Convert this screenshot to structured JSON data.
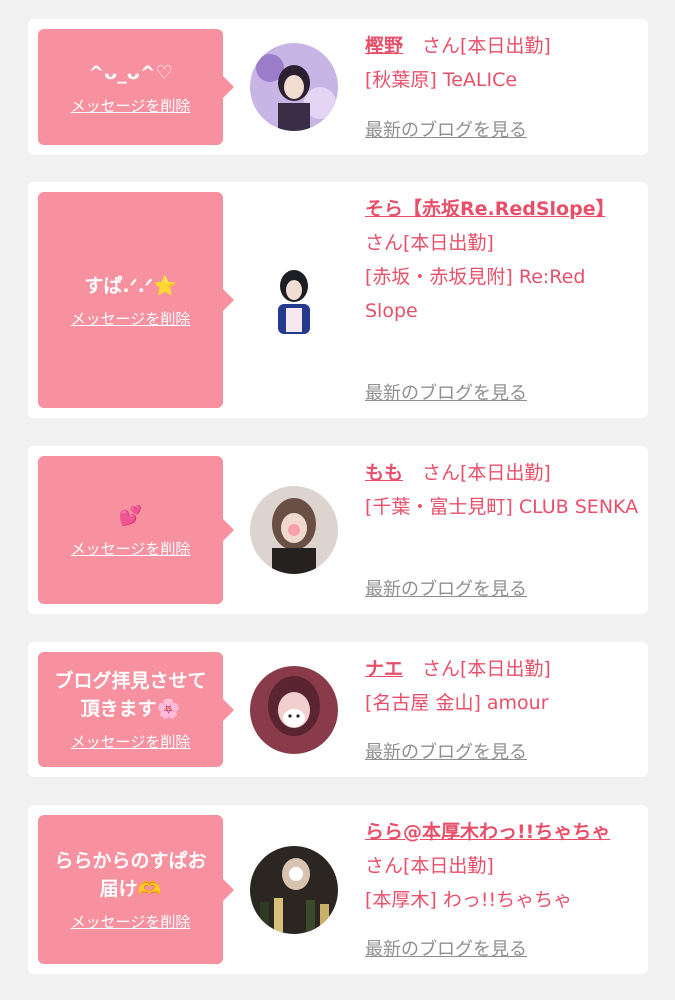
{
  "cards": [
    {
      "message": "^ᴗ_ᴗ^♡",
      "delete_label": "メッセージを削除",
      "name": "樫野",
      "honorific": "　さん[本日出勤]",
      "shop": "[秋葉原] TeALICe",
      "blog_label": "最新のブログを見る"
    },
    {
      "message": "すぱ.ᐟ.ᐟ⭐",
      "delete_label": "メッセージを削除",
      "name": "そら【赤坂Re.RedSlope】",
      "honorific": "　さん[本日出勤]",
      "shop": "[赤坂・赤坂見附] Re:Red Slope",
      "blog_label": "最新のブログを見る"
    },
    {
      "message": "💕",
      "delete_label": "メッセージを削除",
      "name": "もも",
      "honorific": "　さん[本日出勤]",
      "shop": "[千葉・富士見町] CLUB SENKA",
      "blog_label": "最新のブログを見る"
    },
    {
      "message": "ブログ拝見させて\n頂きます🌸",
      "delete_label": "メッセージを削除",
      "name": "ナエ",
      "honorific": "　さん[本日出勤]",
      "shop": "[名古屋 金山] amour",
      "blog_label": "最新のブログを見る"
    },
    {
      "message": "ららからのすぱお\n届け🫶",
      "delete_label": "メッセージを削除",
      "name": "らら@本厚木わっ!!ちゃちゃ",
      "honorific": "　さん[本日出勤]",
      "shop": "[本厚木] わっ!!ちゃちゃ",
      "blog_label": "最新のブログを見る"
    }
  ],
  "colors": {
    "bubble": "#f7909f",
    "accent": "#e8506a",
    "link_gray": "#8f8f8f",
    "background": "#f1f1f1"
  }
}
